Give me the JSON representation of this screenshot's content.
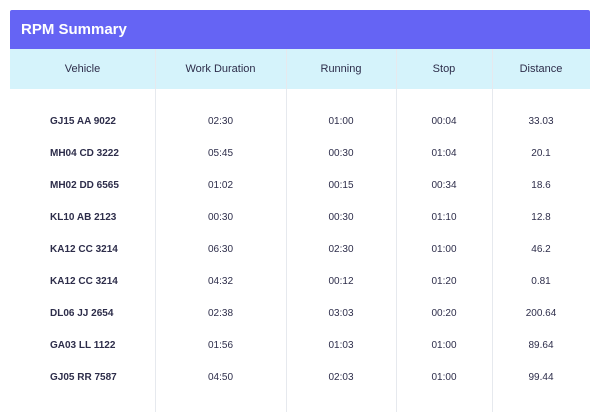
{
  "panel": {
    "title": "RPM Summary"
  },
  "columns": [
    "Vehicle",
    "Work Duration",
    "Running",
    "Stop",
    "Distance"
  ],
  "rows": [
    {
      "vehicle": "GJ15 AA 9022",
      "work_duration": "02:30",
      "running": "01:00",
      "stop": "00:04",
      "distance": "33.03"
    },
    {
      "vehicle": "MH04 CD 3222",
      "work_duration": "05:45",
      "running": "00:30",
      "stop": "01:04",
      "distance": "20.1"
    },
    {
      "vehicle": "MH02 DD 6565",
      "work_duration": "01:02",
      "running": "00:15",
      "stop": "00:34",
      "distance": "18.6"
    },
    {
      "vehicle": "KL10 AB 2123",
      "work_duration": "00:30",
      "running": "00:30",
      "stop": "01:10",
      "distance": "12.8"
    },
    {
      "vehicle": "KA12 CC 3214",
      "work_duration": "06:30",
      "running": "02:30",
      "stop": "01:00",
      "distance": "46.2"
    },
    {
      "vehicle": "KA12 CC 3214",
      "work_duration": "04:32",
      "running": "00:12",
      "stop": "01:20",
      "distance": "0.81"
    },
    {
      "vehicle": "DL06 JJ 2654",
      "work_duration": "02:38",
      "running": "03:03",
      "stop": "00:20",
      "distance": "200.64"
    },
    {
      "vehicle": "GA03 LL 1122",
      "work_duration": "01:56",
      "running": "01:03",
      "stop": "01:00",
      "distance": "89.64"
    },
    {
      "vehicle": "GJ05 RR 7587",
      "work_duration": "04:50",
      "running": "02:03",
      "stop": "01:00",
      "distance": "99.44"
    }
  ],
  "colors": {
    "title_bar": "#6564f4",
    "header_bg": "#d5f3fb",
    "text": "#2d2d4a"
  }
}
